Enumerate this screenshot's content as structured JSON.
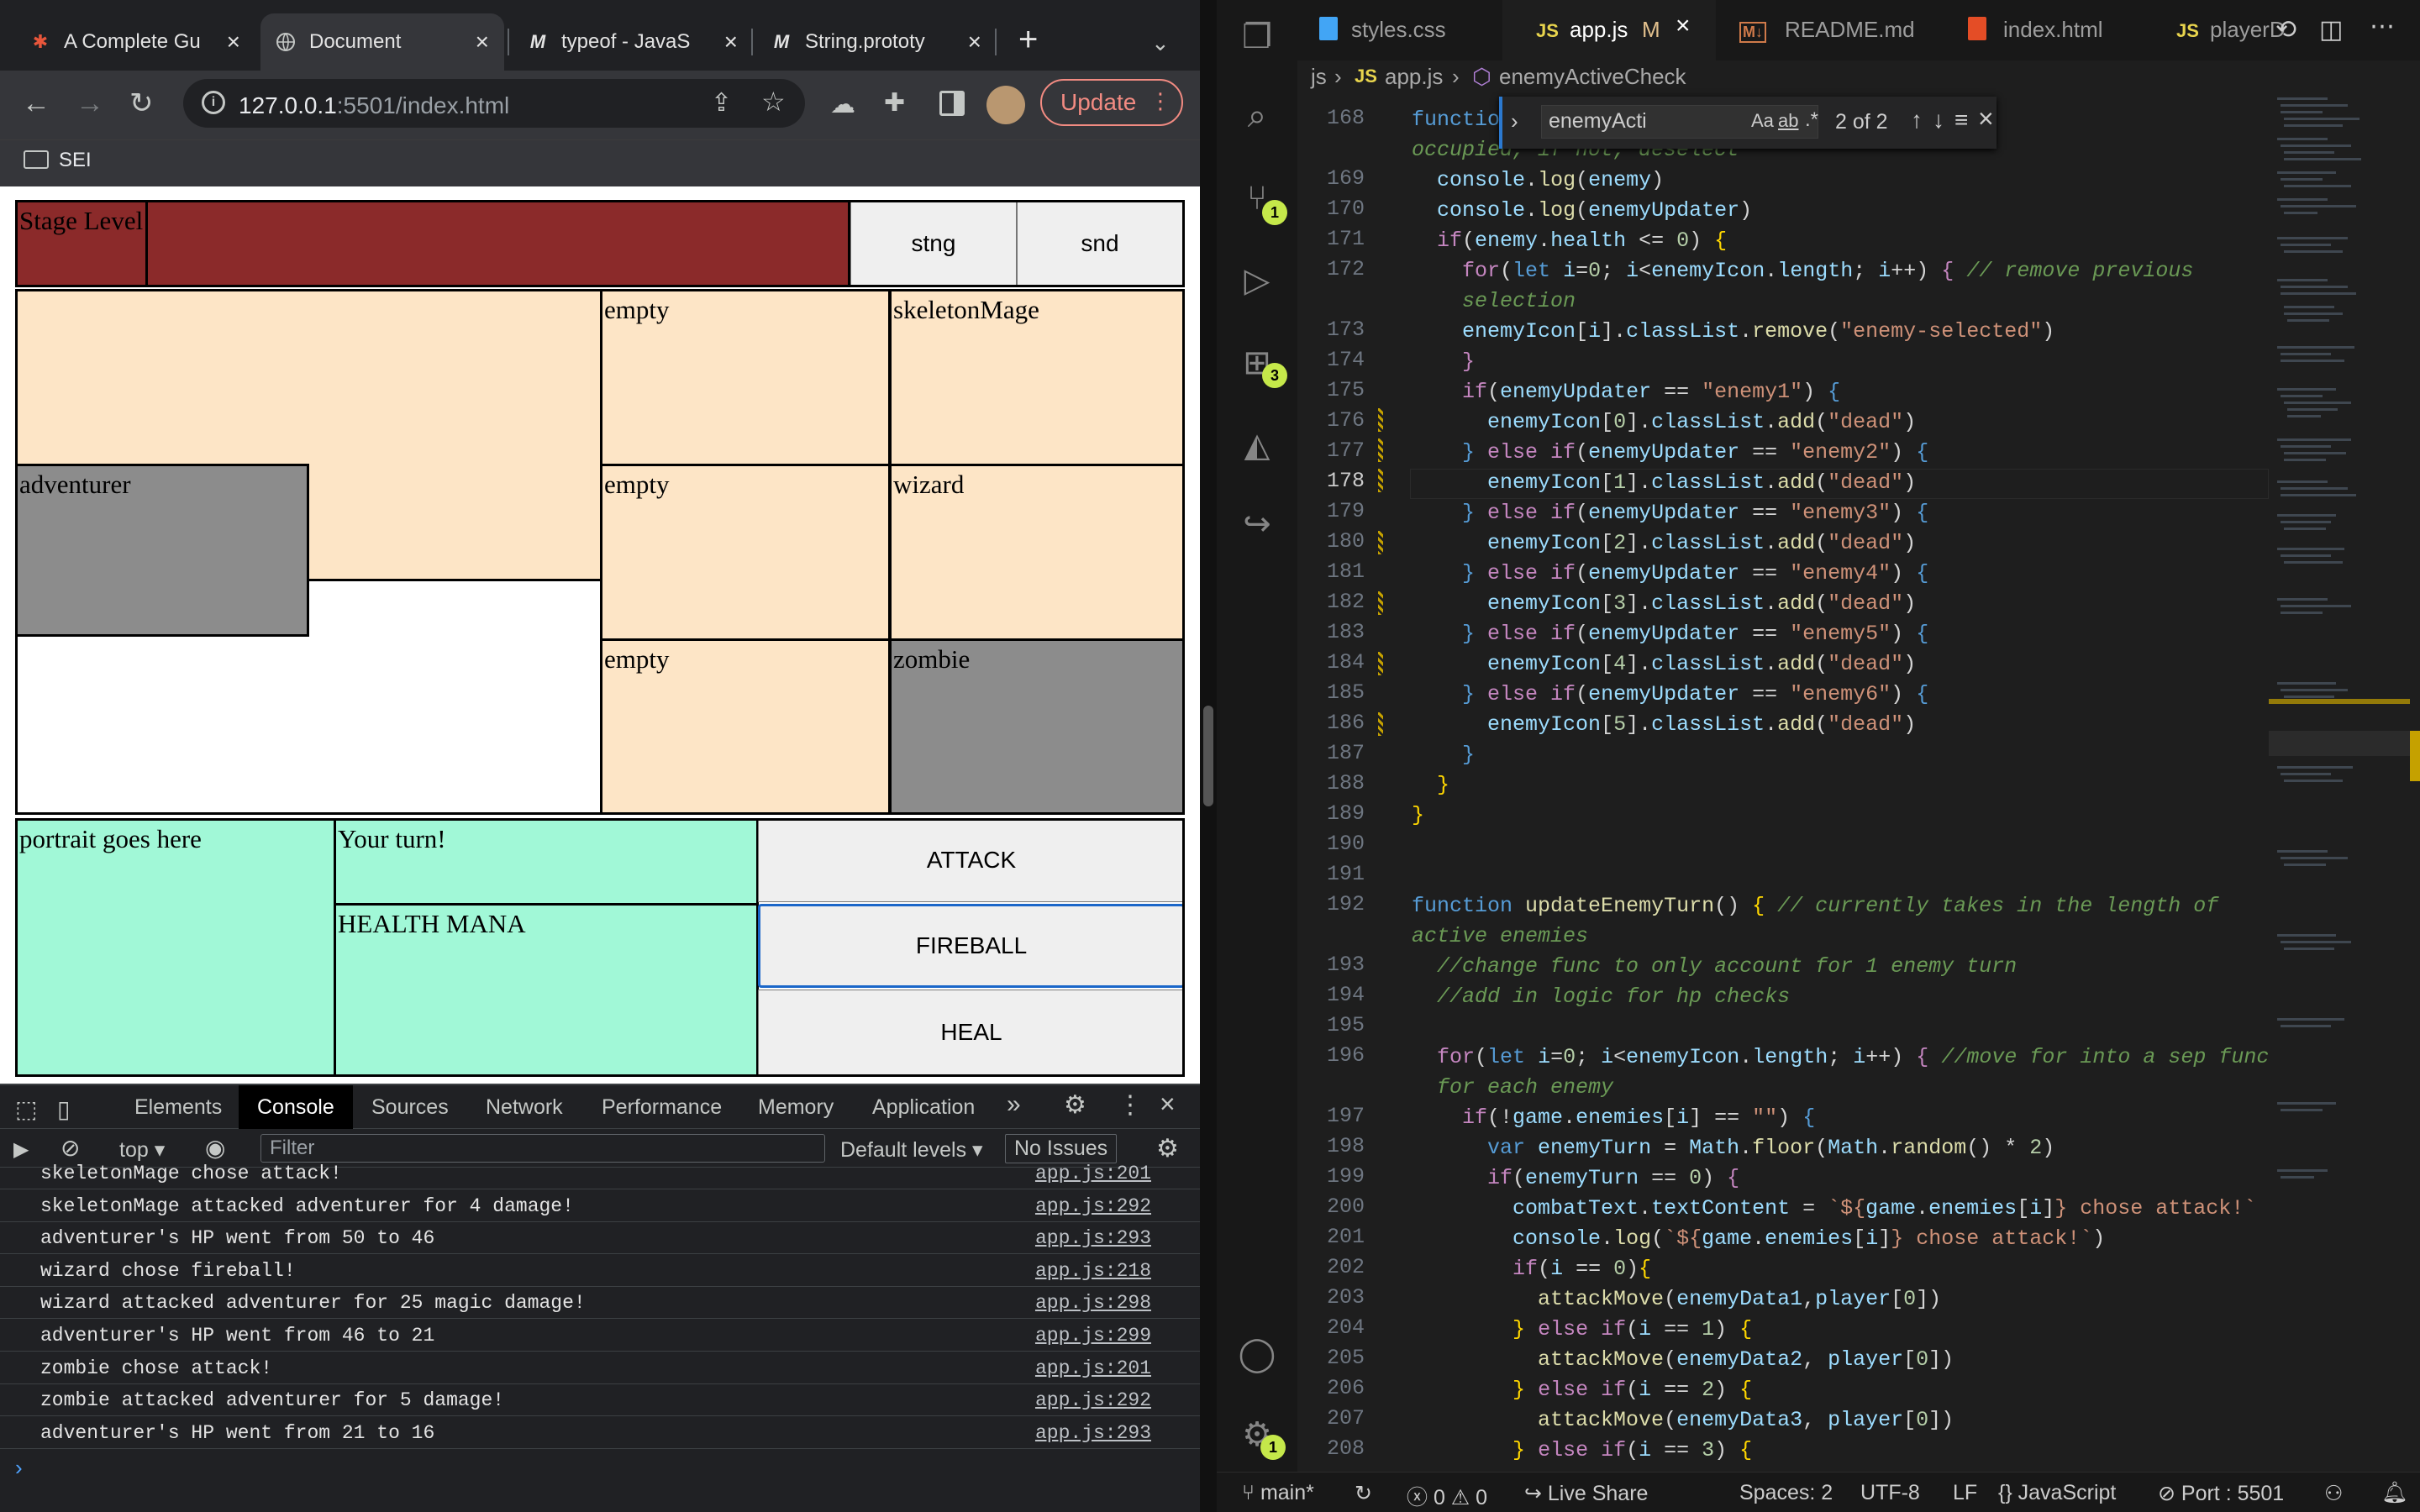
{
  "browser": {
    "tabs": [
      {
        "title": "A Complete Gu",
        "icon": "asterisk-icon"
      },
      {
        "title": "Document",
        "icon": "globe-icon"
      },
      {
        "title": "typeof - JavaS",
        "icon": "mdn-icon"
      },
      {
        "title": "String.prototy",
        "icon": "mdn-icon"
      }
    ],
    "url_host": "127.0.0.1",
    "url_path": ":5501/index.html",
    "update_label": "Update",
    "bookmark": "SEI"
  },
  "game": {
    "stage_label": "Stage Level",
    "stng": "stng",
    "snd": "snd",
    "player": "adventurer",
    "enemies": [
      "empty",
      "skeletonMage",
      "empty",
      "wizard",
      "empty",
      "zombie"
    ],
    "portrait": "portrait goes here",
    "turn_text": "Your turn!",
    "stats": "HEALTH MANA",
    "buttons": [
      "ATTACK",
      "FIREBALL",
      "HEAL"
    ]
  },
  "devtools": {
    "tabs": [
      "Elements",
      "Console",
      "Sources",
      "Network",
      "Performance",
      "Memory",
      "Application"
    ],
    "context": "top",
    "filter_placeholder": "Filter",
    "levels": "Default levels",
    "issues": "No Issues",
    "log": [
      {
        "msg": "skeletonMage chose attack!",
        "src": "app.js:201"
      },
      {
        "msg": "skeletonMage attacked adventurer for 4 damage!",
        "src": "app.js:292"
      },
      {
        "msg": "adventurer's HP went from 50 to 46",
        "src": "app.js:293"
      },
      {
        "msg": "wizard chose fireball!",
        "src": "app.js:218"
      },
      {
        "msg": "wizard attacked adventurer for 25 magic damage!",
        "src": "app.js:298"
      },
      {
        "msg": "adventurer's HP went from 46 to 21",
        "src": "app.js:299"
      },
      {
        "msg": "zombie chose attack!",
        "src": "app.js:201"
      },
      {
        "msg": "zombie attacked adventurer for 5 damage!",
        "src": "app.js:292"
      },
      {
        "msg": "adventurer's HP went from 21 to 16",
        "src": "app.js:293"
      }
    ]
  },
  "vscode": {
    "tabs": [
      {
        "label": "styles.css",
        "icon": "css-icon"
      },
      {
        "label": "app.js",
        "icon": "js-icon",
        "modified": "M"
      },
      {
        "label": "README.md",
        "icon": "markdown-icon"
      },
      {
        "label": "index.html",
        "icon": "html-icon"
      },
      {
        "label": "playerD",
        "icon": "js-icon"
      }
    ],
    "breadcrumb": [
      "js",
      "app.js",
      "enemyActiveCheck"
    ],
    "find_query": "enemyActi",
    "find_count": "2 of 2",
    "badges": {
      "scm": "1",
      "extensions": "3",
      "settings": "1"
    },
    "line_numbers": [
      "168",
      "",
      "169",
      "170",
      "171",
      "172",
      "",
      "173",
      "174",
      "175",
      "176",
      "177",
      "178",
      "179",
      "180",
      "181",
      "182",
      "183",
      "184",
      "185",
      "186",
      "187",
      "188",
      "189",
      "190",
      "191",
      "192",
      "",
      "193",
      "194",
      "195",
      "196",
      "",
      "197",
      "198",
      "199",
      "200",
      "201",
      "202",
      "203",
      "204",
      "205",
      "206",
      "207",
      "208"
    ],
    "status": {
      "branch": "main*",
      "errors": "0",
      "warnings": "0",
      "live_share": "Live Share",
      "spaces": "Spaces: 2",
      "encoding": "UTF-8",
      "eol": "LF",
      "language": "JavaScript",
      "port": "Port : 5501"
    }
  }
}
